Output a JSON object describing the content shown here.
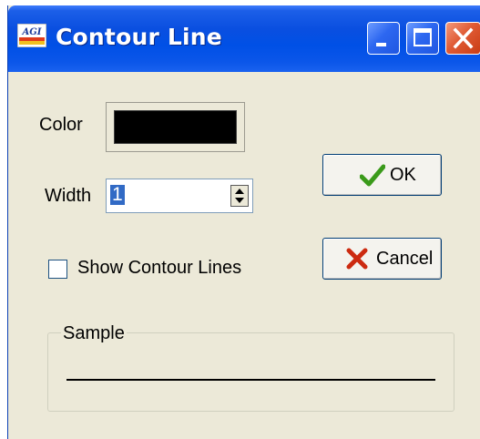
{
  "window": {
    "title": "Contour Line",
    "app_icon_text": "AGI"
  },
  "form": {
    "color_label": "Color",
    "color_value": "#000000",
    "width_label": "Width",
    "width_value": "1",
    "show_contour_label": "Show Contour Lines",
    "show_contour_checked": false
  },
  "buttons": {
    "ok_label": "OK",
    "cancel_label": "Cancel"
  },
  "sample": {
    "legend": "Sample"
  }
}
